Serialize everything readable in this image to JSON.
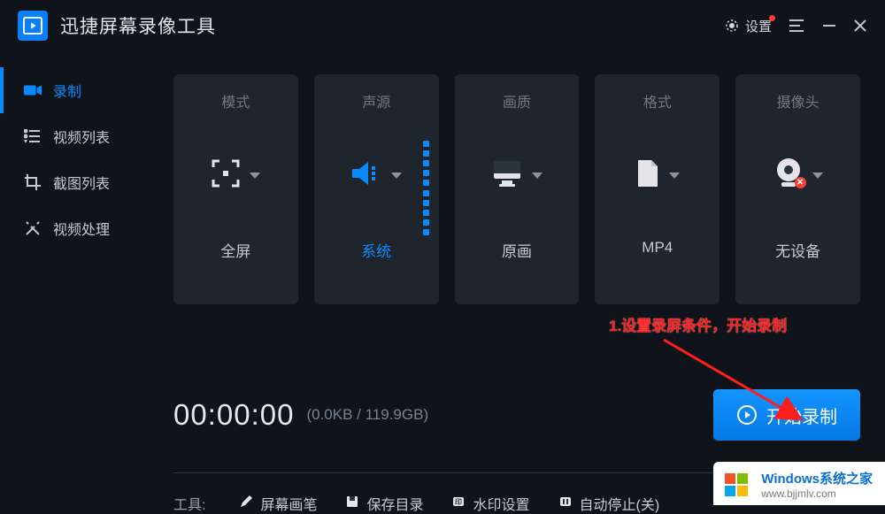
{
  "titlebar": {
    "app_title": "迅捷屏幕录像工具",
    "settings_label": "设置"
  },
  "sidebar": {
    "items": [
      {
        "label": "录制"
      },
      {
        "label": "视频列表"
      },
      {
        "label": "截图列表"
      },
      {
        "label": "视频处理"
      }
    ]
  },
  "cards": [
    {
      "title": "模式",
      "value": "全屏",
      "accent": false
    },
    {
      "title": "声源",
      "value": "系统",
      "accent": true
    },
    {
      "title": "画质",
      "value": "原画",
      "accent": false
    },
    {
      "title": "格式",
      "value": "MP4",
      "accent": false
    },
    {
      "title": "摄像头",
      "value": "无设备",
      "accent": false
    }
  ],
  "annotation": "1.设置录屏条件，开始录制",
  "timer": "00:00:00",
  "size_info": "(0.0KB / 119.9GB)",
  "start_btn": "开始录制",
  "tools": {
    "label": "工具:",
    "items": [
      {
        "label": "屏幕画笔"
      },
      {
        "label": "保存目录"
      },
      {
        "label": "水印设置"
      },
      {
        "label": "自动停止(关)"
      }
    ]
  },
  "watermark": {
    "title": "Windows系统之家",
    "url": "www.bjjmlv.com"
  }
}
